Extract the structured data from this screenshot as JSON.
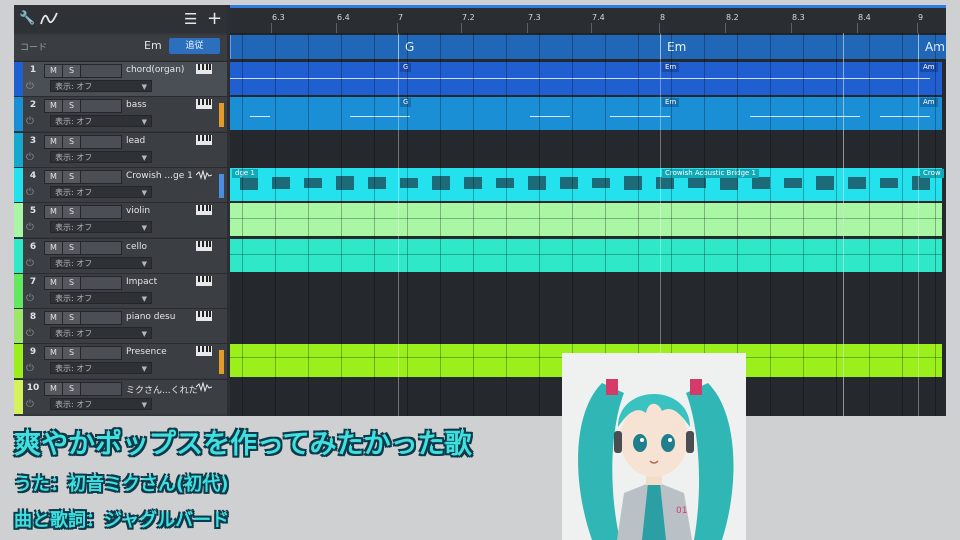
{
  "toolbar": {
    "tool_icon": "wrench-icon",
    "curve_icon": "curve-icon",
    "list_icon": "list-icon",
    "add_icon": "plus-icon"
  },
  "chord_track": {
    "label": "コード",
    "key": "Em",
    "follow_button": "追従"
  },
  "ruler": [
    "6.3",
    "6.4",
    "7",
    "7.2",
    "7.3",
    "7.4",
    "8",
    "8.2",
    "8.3",
    "8.4",
    "9"
  ],
  "chords": [
    "G",
    "Em",
    "Am"
  ],
  "tracks": [
    {
      "num": "1",
      "mute": "M",
      "solo": "S",
      "name": "chord(organ)",
      "display": "表示: オフ",
      "color": "#1f5fd0",
      "icon": "piano-icon"
    },
    {
      "num": "2",
      "mute": "M",
      "solo": "S",
      "name": "bass",
      "display": "表示: オフ",
      "color": "#1b8fd6",
      "icon": "piano-icon"
    },
    {
      "num": "3",
      "mute": "M",
      "solo": "S",
      "name": "lead",
      "display": "表示: オフ",
      "color": "#16a9cf",
      "icon": "piano-icon"
    },
    {
      "num": "4",
      "mute": "M",
      "solo": "S",
      "name": "Crowish ...ge 1",
      "display": "表示: オフ",
      "color": "#23e2ee",
      "icon": "waveform-icon"
    },
    {
      "num": "5",
      "mute": "M",
      "solo": "S",
      "name": "violin",
      "display": "表示: オフ",
      "color": "#a9f7a5",
      "icon": "piano-icon"
    },
    {
      "num": "6",
      "mute": "M",
      "solo": "S",
      "name": "cello",
      "display": "表示: オフ",
      "color": "#2ee8c8",
      "icon": "piano-icon"
    },
    {
      "num": "7",
      "mute": "M",
      "solo": "S",
      "name": "Impact",
      "display": "表示: オフ",
      "color": "#64e860",
      "icon": "piano-icon"
    },
    {
      "num": "8",
      "mute": "M",
      "solo": "S",
      "name": "piano desu",
      "display": "表示: オフ",
      "color": "#9ee76a",
      "icon": "piano-icon"
    },
    {
      "num": "9",
      "mute": "M",
      "solo": "S",
      "name": "Presence",
      "display": "表示: オフ",
      "color": "#9bef1b",
      "icon": "piano-icon"
    },
    {
      "num": "10",
      "mute": "M",
      "solo": "S",
      "name": "ミクさん...くれたよ",
      "display": "表示: オフ",
      "color": "#d6f25a",
      "icon": "waveform-icon"
    }
  ],
  "part_tags": {
    "t1": [
      "G",
      "Em",
      "Am"
    ],
    "t2": [
      "G",
      "Em",
      "Am"
    ],
    "t4": [
      "dge 1",
      "Crowish Acoustic Bridge 1",
      "Crow"
    ]
  },
  "overlay": {
    "title": "爽やかポップスを作ってみたかった歌",
    "singer": "うた：初音ミクさん(初代)",
    "credit": "曲と歌詞：ジャグルバード"
  }
}
